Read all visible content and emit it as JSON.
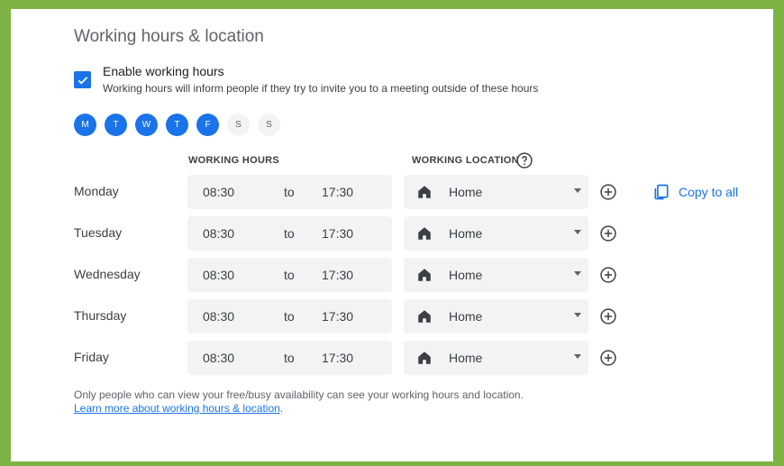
{
  "section_title": "Working hours & location",
  "enable": {
    "checked": true,
    "label": "Enable working hours",
    "description": "Working hours will inform people if they try to invite you to a meeting outside of these hours"
  },
  "days": [
    {
      "letter": "M",
      "active": true
    },
    {
      "letter": "T",
      "active": true
    },
    {
      "letter": "W",
      "active": true
    },
    {
      "letter": "T",
      "active": true
    },
    {
      "letter": "F",
      "active": true
    },
    {
      "letter": "S",
      "active": false
    },
    {
      "letter": "S",
      "active": false
    }
  ],
  "headers": {
    "working_hours": "WORKING HOURS",
    "working_location": "WORKING LOCATION"
  },
  "rows": [
    {
      "day": "Monday",
      "start": "08:30",
      "sep": "to",
      "end": "17:30",
      "location": "Home"
    },
    {
      "day": "Tuesday",
      "start": "08:30",
      "sep": "to",
      "end": "17:30",
      "location": "Home"
    },
    {
      "day": "Wednesday",
      "start": "08:30",
      "sep": "to",
      "end": "17:30",
      "location": "Home"
    },
    {
      "day": "Thursday",
      "start": "08:30",
      "sep": "to",
      "end": "17:30",
      "location": "Home"
    },
    {
      "day": "Friday",
      "start": "08:30",
      "sep": "to",
      "end": "17:30",
      "location": "Home"
    }
  ],
  "copy_to_all": "Copy to all",
  "footer": {
    "note": "Only people who can view your free/busy availability can see your working hours and location.",
    "link_text": "Learn more about working hours & location",
    "link_suffix": "."
  },
  "colors": {
    "accent": "#1a73e8",
    "frame": "#7cb342",
    "field_bg": "#f1f3f4"
  }
}
